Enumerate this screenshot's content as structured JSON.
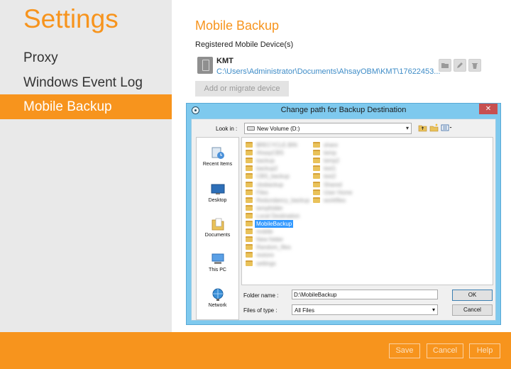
{
  "sidebar": {
    "title": "Settings",
    "items": [
      {
        "label": "Proxy"
      },
      {
        "label": "Windows Event Log"
      },
      {
        "label": "Mobile Backup"
      }
    ]
  },
  "main": {
    "title": "Mobile Backup",
    "registered_label": "Registered Mobile Device(s)",
    "device": {
      "name": "KMT",
      "path": "C:\\Users\\Administrator\\Documents\\AhsayOBM\\KMT\\17622453..."
    },
    "add_migrate_label": "Add or migrate device"
  },
  "dialog": {
    "title": "Change path for Backup Destination",
    "close_symbol": "✕",
    "look_in_label": "Look in :",
    "look_in_value": "New Volume (D:)",
    "places": [
      {
        "label": "Recent Items"
      },
      {
        "label": "Desktop"
      },
      {
        "label": "Documents"
      },
      {
        "label": "This PC"
      },
      {
        "label": "Network"
      }
    ],
    "folders_col1": [
      "$RECYCLE.BIN",
      "AhsayCBS",
      "backup",
      "backup2",
      "CBS_backup",
      "cbsbackup",
      "Files",
      "Redundancy_backup",
      "tempfolder",
      "Local Destination",
      "MobileBackup",
      "mobile",
      "New folder",
      "Random_files",
      "restore",
      "settings"
    ],
    "folders_col2": [
      "share",
      "temp",
      "temp2",
      "test1",
      "test2",
      "Shared",
      "User Home",
      "workfiles"
    ],
    "selected_folder": "MobileBackup",
    "folder_name_label": "Folder name :",
    "folder_name_value": "D:\\MobileBackup",
    "files_of_type_label": "Files of type :",
    "files_of_type_value": "All Files",
    "ok_label": "OK",
    "cancel_label": "Cancel"
  },
  "footer": {
    "save_label": "Save",
    "cancel_label": "Cancel",
    "help_label": "Help"
  },
  "colors": {
    "accent": "#f7941d",
    "link": "#3e8cc7",
    "dialog_frame": "#7ec9ee",
    "selection": "#3399ff"
  }
}
